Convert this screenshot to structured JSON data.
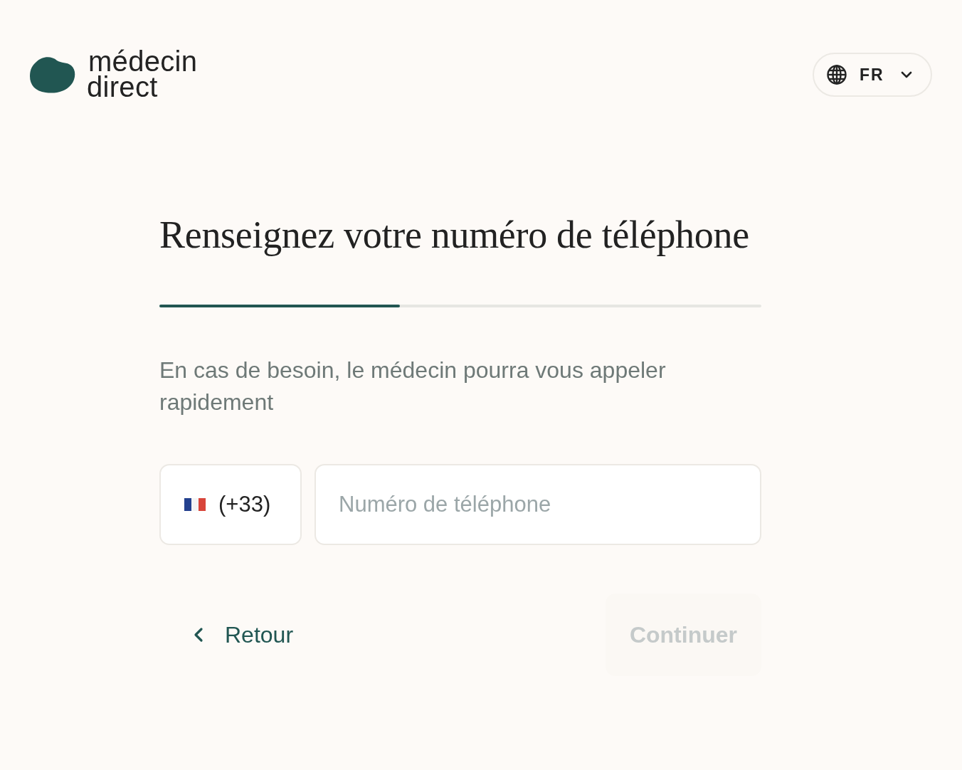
{
  "header": {
    "logo": {
      "line_1": "médecin",
      "line_2": "direct"
    },
    "language": {
      "label": "FR"
    }
  },
  "title": "Renseignez votre numéro de téléphone",
  "progress": {
    "level": 0.4
  },
  "subtitle": "En cas de besoin, le médecin pourra vous appeler rapidement",
  "phone": {
    "country_code": "(+33)",
    "placeholder": "Numéro de téléphone"
  },
  "actions": {
    "back": {
      "label": "Retour"
    },
    "continue": {
      "label": "Continuer",
      "disabled": true
    }
  }
}
